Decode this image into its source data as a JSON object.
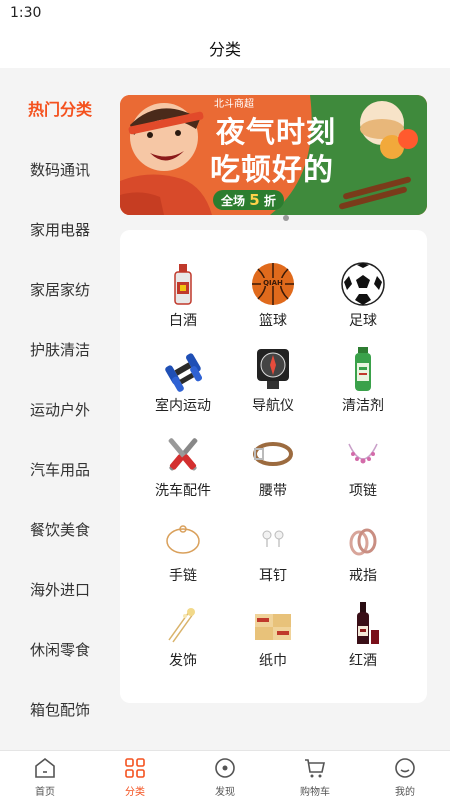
{
  "status_bar": {
    "time": "1:30"
  },
  "header": {
    "title": "分类"
  },
  "sidebar": {
    "items": [
      {
        "label": "热门分类",
        "active": true
      },
      {
        "label": "数码通讯"
      },
      {
        "label": "家用电器"
      },
      {
        "label": "家居家纺"
      },
      {
        "label": "护肤清洁"
      },
      {
        "label": "运动户外"
      },
      {
        "label": "汽车用品"
      },
      {
        "label": "餐饮美食"
      },
      {
        "label": "海外进口"
      },
      {
        "label": "休闲零食"
      },
      {
        "label": "箱包配饰"
      }
    ]
  },
  "banner": {
    "brand": "北斗商超",
    "line1": "夜气时刻",
    "line2": "吃顿好的",
    "badge_prefix": "全场",
    "badge_number": "5",
    "badge_suffix": "折"
  },
  "categories": [
    {
      "label": "白酒",
      "icon": "baijiu-bottle-icon"
    },
    {
      "label": "篮球",
      "icon": "basketball-icon"
    },
    {
      "label": "足球",
      "icon": "soccer-ball-icon"
    },
    {
      "label": "室内运动",
      "icon": "dumbbell-icon"
    },
    {
      "label": "导航仪",
      "icon": "compass-icon"
    },
    {
      "label": "清洁剂",
      "icon": "spray-can-icon"
    },
    {
      "label": "洗车配件",
      "icon": "wrench-icon"
    },
    {
      "label": "腰带",
      "icon": "belt-icon"
    },
    {
      "label": "项链",
      "icon": "necklace-icon"
    },
    {
      "label": "手链",
      "icon": "bracelet-icon"
    },
    {
      "label": "耳钉",
      "icon": "earring-icon"
    },
    {
      "label": "戒指",
      "icon": "ring-icon"
    },
    {
      "label": "发饰",
      "icon": "hairpin-icon"
    },
    {
      "label": "纸巾",
      "icon": "tissue-icon"
    },
    {
      "label": "红酒",
      "icon": "red-wine-icon"
    }
  ],
  "tabbar": {
    "items": [
      {
        "label": "首页",
        "icon": "home-icon"
      },
      {
        "label": "分类",
        "icon": "category-icon",
        "active": true
      },
      {
        "label": "发现",
        "icon": "discover-icon"
      },
      {
        "label": "购物车",
        "icon": "cart-icon"
      },
      {
        "label": "我的",
        "icon": "profile-icon"
      }
    ]
  },
  "colors": {
    "accent": "#f4511e",
    "banner_bg": "#ea6a34",
    "badge_bg": "#2c7d2f"
  }
}
